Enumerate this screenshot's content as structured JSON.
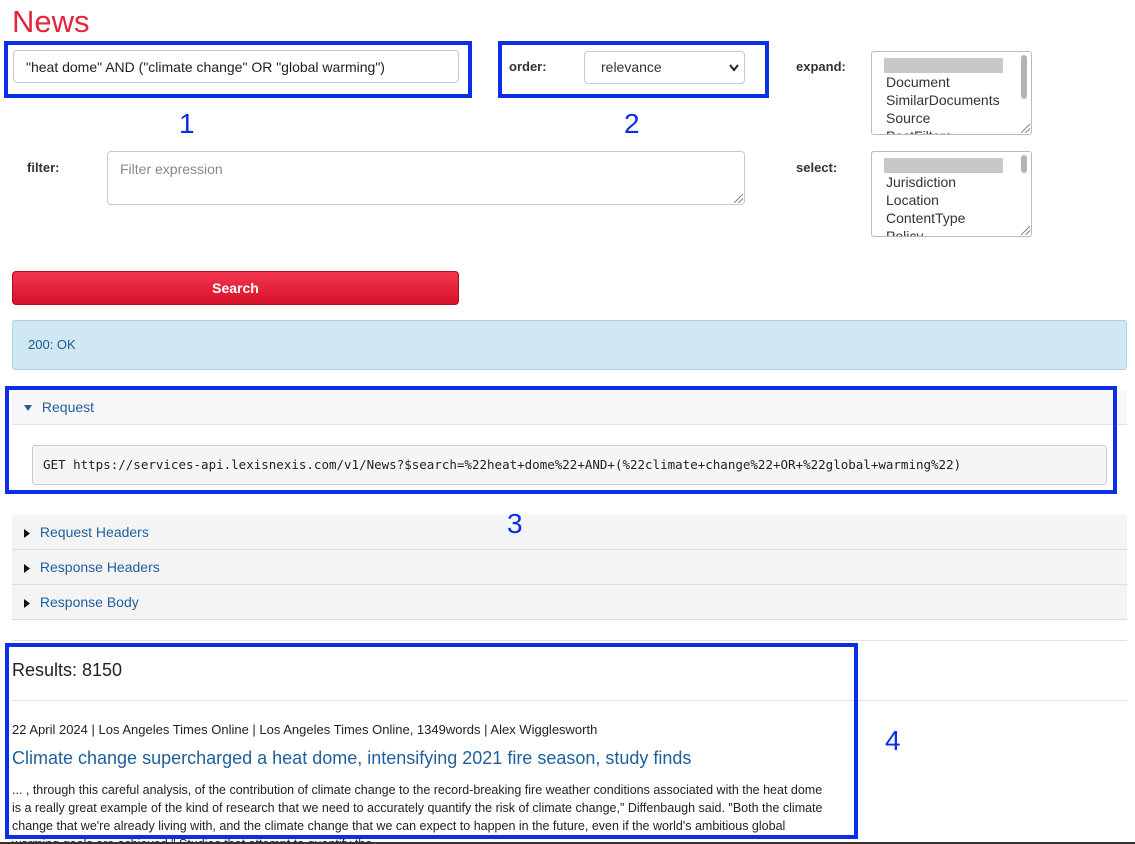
{
  "page_title": "News",
  "search": {
    "value": "\"heat dome\" AND (\"climate change\" OR \"global warming\")"
  },
  "order": {
    "label": "order:",
    "value": "relevance"
  },
  "expand": {
    "label": "expand:",
    "options": [
      "Document",
      "SimilarDocuments",
      "Source",
      "PostFilters"
    ]
  },
  "filter": {
    "label": "filter:",
    "placeholder": "Filter expression"
  },
  "select": {
    "label": "select:",
    "options": [
      "Jurisdiction",
      "Location",
      "ContentType",
      "Policy"
    ]
  },
  "search_button": "Search",
  "status": "200: OK",
  "request": {
    "label": "Request",
    "url": "GET https://services-api.lexisnexis.com/v1/News?$search=%22heat+dome%22+AND+(%22climate+change%22+OR+%22global+warming%22)"
  },
  "sections": [
    "Request Headers",
    "Response Headers",
    "Response Body"
  ],
  "results": {
    "count_label": "Results: 8150",
    "items": [
      {
        "meta": "22 April 2024 | Los Angeles Times Online | Los Angeles Times Online, 1349words | Alex Wigglesworth",
        "title": "Climate change supercharged a heat dome, intensifying 2021 fire season, study finds",
        "snippet": "... , through this careful analysis, of the contribution of climate change to the record-breaking fire weather conditions associated with the heat dome is a really great example of the kind of research that we need to accurately quantify the risk of climate change,\" Diffenbaugh said. \"Both the climate change that we're already living with, and the climate change that we can expect to happen in the future, even if the world's ambitious global warming goals are achieved.\" Studies that attempt to quantify the"
      }
    ]
  },
  "annotations": [
    "1",
    "2",
    "3",
    "4"
  ],
  "colors": {
    "brand_red": "#e5243b",
    "highlight_blue": "#0a2fe6",
    "link_blue": "#1f5f9c"
  }
}
